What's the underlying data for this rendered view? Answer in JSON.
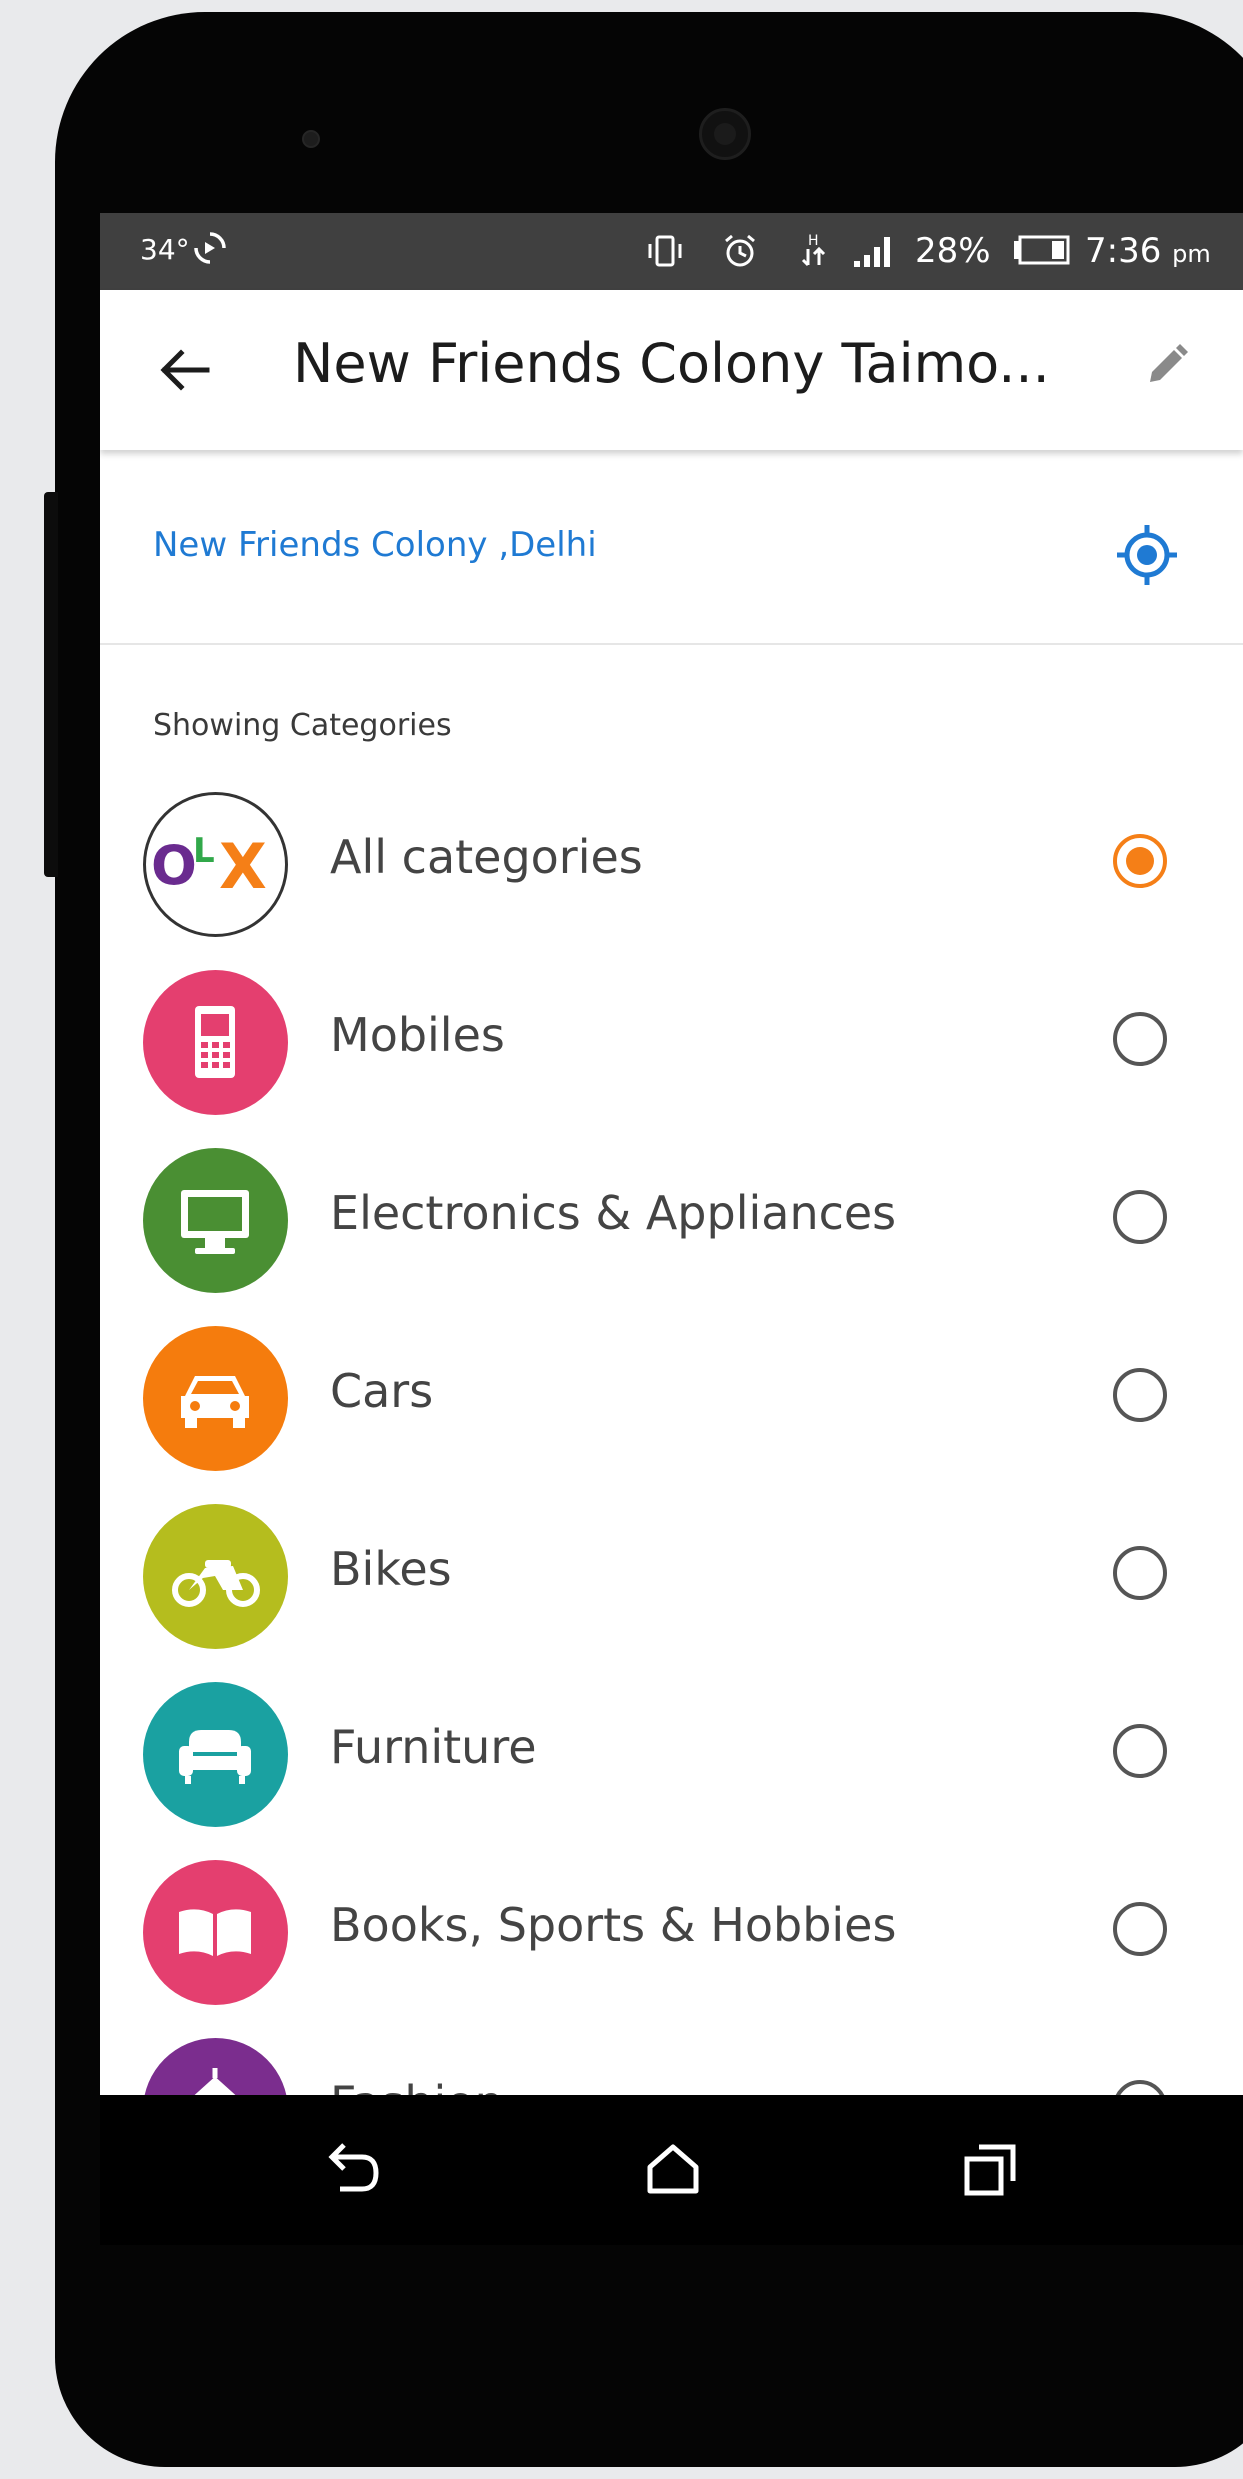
{
  "status_bar": {
    "temperature": "34°",
    "battery_percent": "28%",
    "time": "7:36",
    "time_suffix": "pm",
    "icons": [
      "auto-rotate-icon",
      "vibrate-icon",
      "alarm-icon",
      "data-arrows-icon",
      "signal-icon",
      "battery-icon"
    ]
  },
  "app_bar": {
    "title": "New Friends Colony Taimo...",
    "back_icon": "arrow-left-icon",
    "edit_icon": "pencil-icon"
  },
  "location": {
    "text": "New Friends Colony ,Delhi",
    "icon": "gps-locate-icon",
    "accent_color": "#1f7ad3"
  },
  "categories_section": {
    "label": "Showing Categories",
    "selected_color": "#f57f17",
    "items": [
      {
        "label": "All categories",
        "icon": "olx-logo",
        "color": "#ffffff",
        "selected": true
      },
      {
        "label": "Mobiles",
        "icon": "mobile-phone-icon",
        "color": "#e43f6f",
        "selected": false
      },
      {
        "label": "Electronics & Appliances",
        "icon": "monitor-icon",
        "color": "#4a8f33",
        "selected": false
      },
      {
        "label": "Cars",
        "icon": "car-icon",
        "color": "#f57c0d",
        "selected": false
      },
      {
        "label": "Bikes",
        "icon": "motorbike-icon",
        "color": "#b5bd1e",
        "selected": false
      },
      {
        "label": "Furniture",
        "icon": "sofa-icon",
        "color": "#1aa1a1",
        "selected": false
      },
      {
        "label": "Books, Sports & Hobbies",
        "icon": "book-icon",
        "color": "#e43f6f",
        "selected": false
      },
      {
        "label": "Fashion",
        "icon": "fashion-icon",
        "color": "#7b2d8e",
        "selected": false
      }
    ]
  },
  "navigation_bar": {
    "buttons": [
      "back-nav-icon",
      "home-nav-icon",
      "recents-nav-icon"
    ]
  }
}
